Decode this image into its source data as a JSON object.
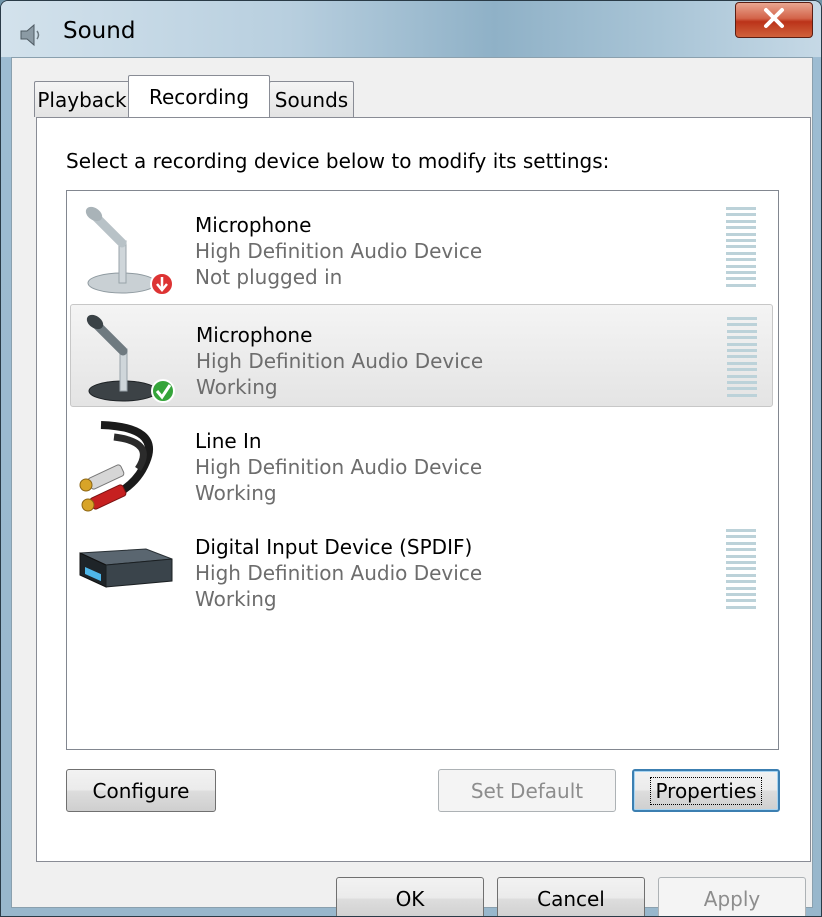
{
  "window": {
    "title": "Sound",
    "close_icon": "close-x"
  },
  "tabs": [
    {
      "label": "Playback",
      "active": false
    },
    {
      "label": "Recording",
      "active": true
    },
    {
      "label": "Sounds",
      "active": false
    }
  ],
  "panel": {
    "prompt": "Select a recording device below to modify its settings:",
    "devices": [
      {
        "name": "Microphone",
        "driver": "High Definition Audio Device",
        "status": "Not plugged in",
        "icon": "microphone-icon",
        "badge": "unplugged-arrow-badge",
        "selected": false,
        "meter": true,
        "level": 0
      },
      {
        "name": "Microphone",
        "driver": "High Definition Audio Device",
        "status": "Working",
        "icon": "microphone-icon",
        "badge": "default-checkmark-badge",
        "selected": true,
        "meter": true,
        "level": 0
      },
      {
        "name": "Line In",
        "driver": "High Definition Audio Device",
        "status": "Working",
        "icon": "rca-cable-icon",
        "selected": false,
        "meter": false
      },
      {
        "name": "Digital Input Device (SPDIF)",
        "driver": "High Definition Audio Device",
        "status": "Working",
        "icon": "spdif-receiver-icon",
        "selected": false,
        "meter": true,
        "level": 0
      }
    ],
    "buttons": {
      "configure": {
        "label": "Configure",
        "enabled": true
      },
      "set_default": {
        "label": "Set Default",
        "enabled": false
      },
      "properties": {
        "label": "Properties",
        "enabled": true
      }
    }
  },
  "footer": {
    "ok": {
      "label": "OK",
      "enabled": true
    },
    "cancel": {
      "label": "Cancel",
      "enabled": true
    },
    "apply": {
      "label": "Apply",
      "enabled": false
    }
  },
  "colors": {
    "meter_segment": "#bcd2d9",
    "disabled_text": "#8d8d8d",
    "secondary_text": "#6d6d6d"
  }
}
